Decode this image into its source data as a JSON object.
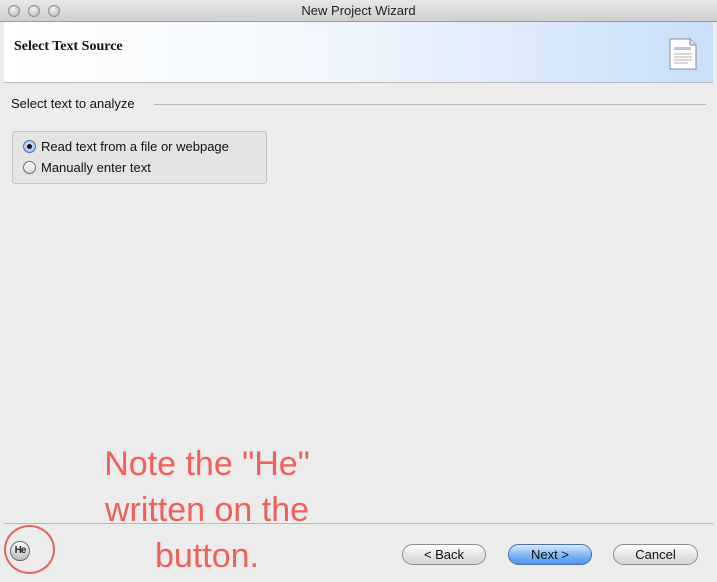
{
  "window": {
    "title": "New Project Wizard",
    "controls": [
      "close-button",
      "minimize-button",
      "zoom-button"
    ]
  },
  "header": {
    "title": "Select Text Source",
    "icon": "wizard-page-icon"
  },
  "group": {
    "label": "Select text to analyze",
    "options": [
      {
        "label": "Read text from a file or webpage",
        "selected": true
      },
      {
        "label": "Manually enter text",
        "selected": false
      }
    ]
  },
  "footer": {
    "help_label": "He",
    "back_label": "< Back",
    "next_label": "Next >",
    "cancel_label": "Cancel"
  },
  "annotation": {
    "text": "Note the \"He\" written on the button.",
    "color": "#ee6058"
  }
}
